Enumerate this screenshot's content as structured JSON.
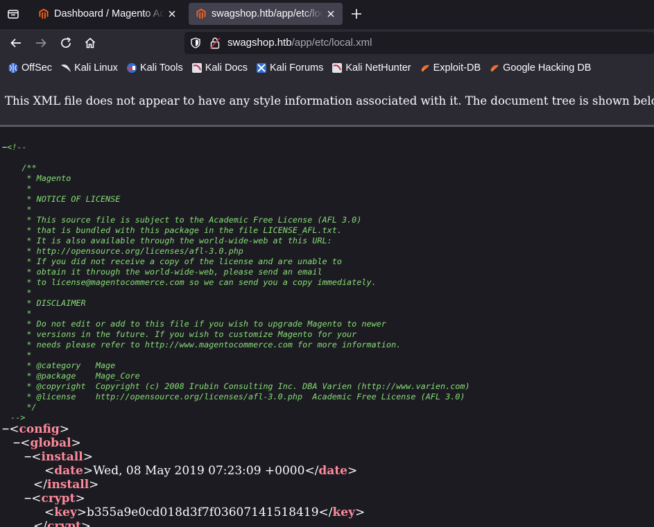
{
  "tabs": [
    {
      "title": "Dashboard / Magento Adm",
      "active": false,
      "favicon": "magento-icon"
    },
    {
      "title": "swagshop.htb/app/etc/loc",
      "active": true,
      "favicon": "magento-icon"
    }
  ],
  "urlbar": {
    "host": "swagshop.htb",
    "path": "/app/etc/local.xml"
  },
  "bookmarks": [
    {
      "label": "OffSec",
      "icon": "offsec-icon"
    },
    {
      "label": "Kali Linux",
      "icon": "kali-dragon-icon"
    },
    {
      "label": "Kali Tools",
      "icon": "kali-tools-icon"
    },
    {
      "label": "Kali Docs",
      "icon": "kali-docs-icon"
    },
    {
      "label": "Kali Forums",
      "icon": "kali-forums-icon"
    },
    {
      "label": "Kali NetHunter",
      "icon": "kali-nethunter-icon"
    },
    {
      "label": "Exploit-DB",
      "icon": "exploit-db-icon"
    },
    {
      "label": "Google Hacking DB",
      "icon": "ghdb-icon"
    }
  ],
  "xml_notice": "This XML file does not appear to have any style information associated with it. The document tree is shown below.",
  "comment": {
    "collapser": "−",
    "open": "<!--",
    "lines": [
      "",
      "   /**",
      "    * Magento",
      "    *",
      "    * NOTICE OF LICENSE",
      "    *",
      "    * This source file is subject to the Academic Free License (AFL 3.0)",
      "    * that is bundled with this package in the file LICENSE_AFL.txt.",
      "    * It is also available through the world-wide-web at this URL:",
      "    * http://opensource.org/licenses/afl-3.0.php",
      "    * If you did not receive a copy of the license and are unable to",
      "    * obtain it through the world-wide-web, please send an email",
      "    * to license@magentocommerce.com so we can send you a copy immediately.",
      "    *",
      "    * DISCLAIMER",
      "    *",
      "    * Do not edit or add to this file if you wish to upgrade Magento to newer",
      "    * versions in the future. If you wish to customize Magento for your",
      "    * needs please refer to http://www.magentocommerce.com for more information.",
      "    *",
      "    * @category   Mage",
      "    * @package    Mage_Core",
      "    * @copyright  Copyright (c) 2008 Irubin Consulting Inc. DBA Varien (http://www.varien.com)",
      "    * @license    http://opensource.org/licenses/afl-3.0.php  Academic Free License (AFL 3.0)",
      "    */"
    ],
    "close": "-->"
  },
  "tree": {
    "config": "config",
    "global": "global",
    "install": "install",
    "date_tag": "date",
    "date_value": "Wed, 08 May 2019 07:23:09 +0000",
    "crypt": "crypt",
    "key_tag": "key",
    "key_value": "b355a9e0cd018d3f7f03607141518419"
  },
  "colors": {
    "tag": "#ff8a9a",
    "comment": "#86de74",
    "background": "#1c1b22",
    "toolbar": "#2b2a33"
  }
}
